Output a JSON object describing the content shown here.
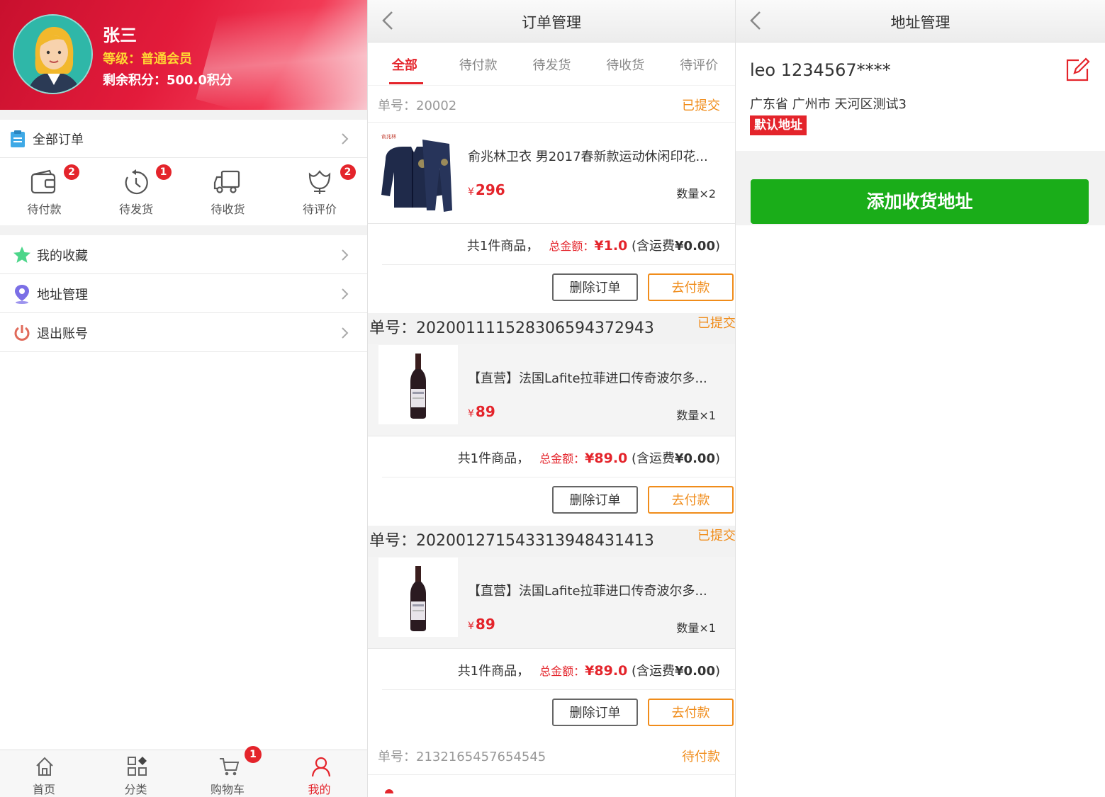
{
  "profile_panel": {
    "user": {
      "name": "张三",
      "level": "等级：普通会员",
      "points": "剩余积分：500.0积分"
    },
    "all_orders": {
      "label": "全部订单"
    },
    "order_status": [
      {
        "label": "待付款",
        "icon": "wallet-icon",
        "badge": "2"
      },
      {
        "label": "待发货",
        "icon": "clock-icon",
        "badge": "1"
      },
      {
        "label": "待收货",
        "icon": "truck-icon",
        "badge": ""
      },
      {
        "label": "待评价",
        "icon": "flower-icon",
        "badge": "2"
      }
    ],
    "menu": [
      {
        "label": "我的收藏",
        "icon": "star-icon"
      },
      {
        "label": "地址管理",
        "icon": "location-pin-icon"
      },
      {
        "label": "退出账号",
        "icon": "power-icon"
      }
    ],
    "tabbar": [
      {
        "label": "首页",
        "icon": "home-icon",
        "active": false
      },
      {
        "label": "分类",
        "icon": "category-icon",
        "active": false
      },
      {
        "label": "购物车",
        "icon": "cart-icon",
        "badge": "1",
        "active": false
      },
      {
        "label": "我的",
        "icon": "user-icon",
        "active": true
      }
    ]
  },
  "orders_panel": {
    "title": "订单管理",
    "tabs": [
      "全部",
      "待付款",
      "待发货",
      "待收货",
      "待评价"
    ],
    "active_tab": "全部",
    "orders": [
      {
        "number": "单号：20002",
        "status": "已提交",
        "product": {
          "name": "俞兆林卫衣 男2017春新款运动休闲印花...",
          "currency": "¥",
          "price": "296",
          "qty": "数量×2",
          "image": "tracksuit-image"
        },
        "summary": {
          "count": "共1件商品，",
          "total_label": "总金额：",
          "total": "¥1.0",
          "ship_prefix": "(含运费",
          "ship": "¥0.00",
          "ship_suffix": ")"
        },
        "buttons": {
          "delete": "删除订单",
          "pay": "去付款"
        }
      },
      {
        "number": "单号：20200111152830659437294​3",
        "status": "已提交",
        "product": {
          "name": "【直营】法国Lafite拉菲进口传奇波尔多...",
          "currency": "¥",
          "price": "89",
          "qty": "数量×1",
          "image": "wine-bottle-image"
        },
        "summary": {
          "count": "共1件商品，",
          "total_label": "总金额：",
          "total": "¥89.0",
          "ship_prefix": "(含运费",
          "ship": "¥0.00",
          "ship_suffix": ")"
        },
        "buttons": {
          "delete": "删除订单",
          "pay": "去付款"
        }
      },
      {
        "number": "单号：202001271543313948431413",
        "status": "已提交",
        "product": {
          "name": "【直营】法国Lafite拉菲进口传奇波尔多...",
          "currency": "¥",
          "price": "89",
          "qty": "数量×1",
          "image": "wine-bottle-image"
        },
        "summary": {
          "count": "共1件商品，",
          "total_label": "总金额：",
          "total": "¥89.0",
          "ship_prefix": "(含运费",
          "ship": "¥0.00",
          "ship_suffix": ")"
        },
        "buttons": {
          "delete": "删除订单",
          "pay": "去付款"
        }
      },
      {
        "number": "单号：2132165457654545",
        "status": "待付款"
      }
    ]
  },
  "address_panel": {
    "title": "地址管理",
    "address": {
      "name_phone": "leo 1234567****",
      "detail": "广东省 广州市 天河区测试3",
      "default_tag": "默认地址"
    },
    "add_button": "添加收货地址"
  },
  "colors": {
    "brand_red": "#e4242b",
    "status_orange": "#f08c1a",
    "add_green": "#1aad19"
  }
}
